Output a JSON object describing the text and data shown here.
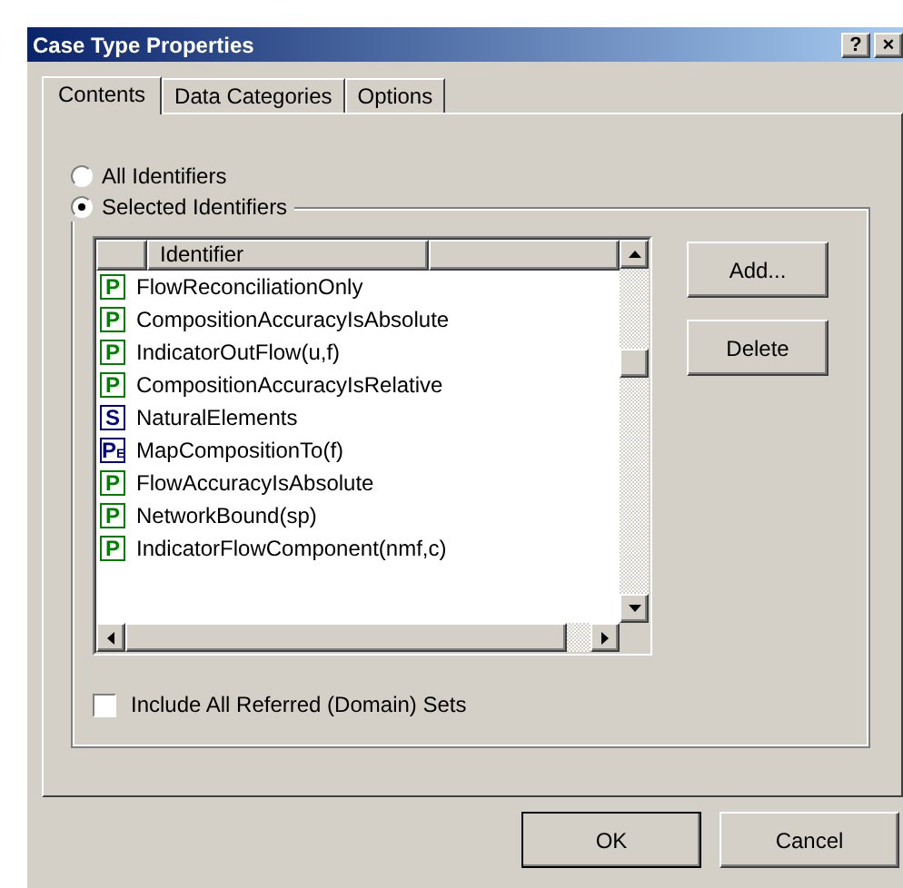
{
  "window": {
    "title": "Case Type Properties",
    "help": "?",
    "close": "×"
  },
  "tabs": [
    {
      "label": "Contents",
      "selected": true
    },
    {
      "label": "Data Categories",
      "selected": false
    },
    {
      "label": "Options",
      "selected": false
    }
  ],
  "scope_options": [
    {
      "label": "All Identifiers",
      "selected": false
    },
    {
      "label": "Selected Identifiers",
      "selected": true
    }
  ],
  "list": {
    "columns": [
      "Identifier"
    ],
    "rows": [
      {
        "badge": "P",
        "color": "#008000",
        "name": "FlowReconciliationOnly"
      },
      {
        "badge": "P",
        "color": "#008000",
        "name": "CompositionAccuracyIsAbsolute"
      },
      {
        "badge": "P",
        "color": "#008000",
        "name": "IndicatorOutFlow(u,f)"
      },
      {
        "badge": "P",
        "color": "#008000",
        "name": "CompositionAccuracyIsRelative"
      },
      {
        "badge": "S",
        "color": "#000080",
        "name": "NaturalElements"
      },
      {
        "badge": "P$_{E}$",
        "color": "#000080",
        "name": "MapCompositionTo(f)"
      },
      {
        "badge": "P",
        "color": "#008000",
        "name": "FlowAccuracyIsAbsolute"
      },
      {
        "badge": "P",
        "color": "#008000",
        "name": "NetworkBound(sp)"
      },
      {
        "badge": "P",
        "color": "#008000",
        "name": "IndicatorFlowComponent(nmf,c)"
      }
    ]
  },
  "side_buttons": [
    "Add...",
    "Delete"
  ],
  "include_referred": {
    "label": "Include All Referred (Domain) Sets",
    "checked": false
  },
  "buttons": [
    {
      "label": "OK",
      "default": true
    },
    {
      "label": "Cancel",
      "default": false
    }
  ]
}
